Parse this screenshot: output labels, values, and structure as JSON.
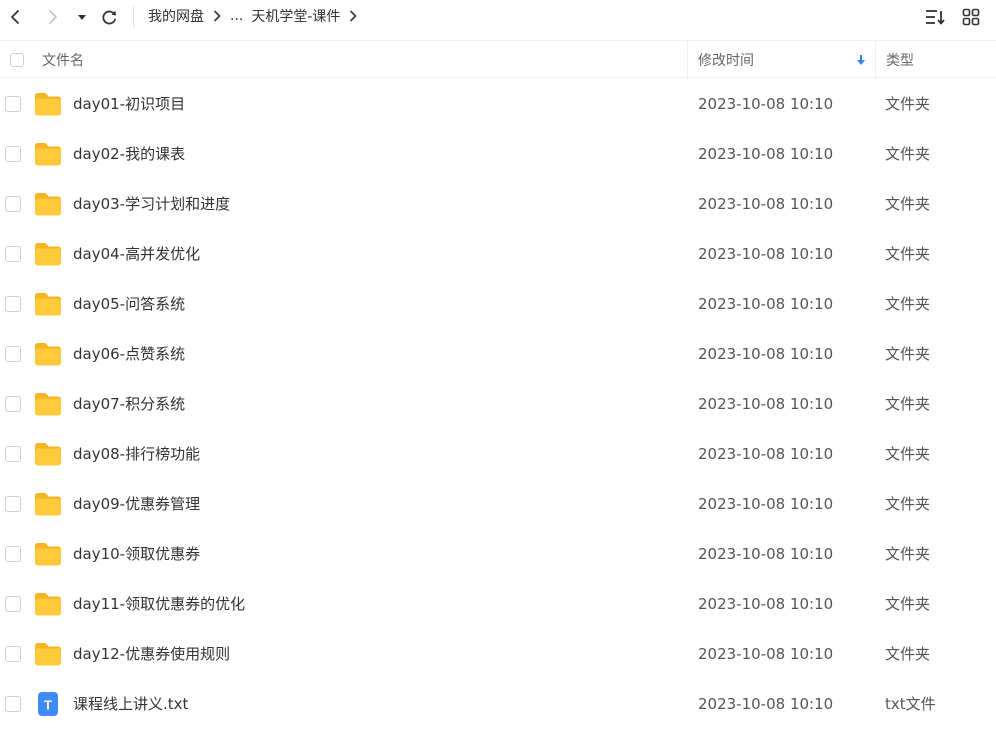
{
  "toolbar": {
    "icons": [
      "back-icon",
      "forward-icon",
      "history-dropdown-icon",
      "refresh-icon",
      "sort-icon",
      "grid-view-icon"
    ]
  },
  "breadcrumb": {
    "root": "我的网盘",
    "ellipsis": "...",
    "current": "天机学堂-课件"
  },
  "header": {
    "name": "文件名",
    "modified": "修改时间",
    "type": "类型"
  },
  "colors": {
    "folder": "#FFC93C",
    "folder_tab": "#F5B520",
    "txt_icon": "#3E8BF5",
    "sort_arrow": "#2E86F0"
  },
  "files": [
    {
      "name": "day01-初识项目",
      "time": "2023-10-08 10:10",
      "type": "文件夹",
      "icon": "folder-icon"
    },
    {
      "name": "day02-我的课表",
      "time": "2023-10-08 10:10",
      "type": "文件夹",
      "icon": "folder-icon"
    },
    {
      "name": "day03-学习计划和进度",
      "time": "2023-10-08 10:10",
      "type": "文件夹",
      "icon": "folder-icon"
    },
    {
      "name": "day04-高并发优化",
      "time": "2023-10-08 10:10",
      "type": "文件夹",
      "icon": "folder-icon"
    },
    {
      "name": "day05-问答系统",
      "time": "2023-10-08 10:10",
      "type": "文件夹",
      "icon": "folder-icon"
    },
    {
      "name": "day06-点赞系统",
      "time": "2023-10-08 10:10",
      "type": "文件夹",
      "icon": "folder-icon"
    },
    {
      "name": "day07-积分系统",
      "time": "2023-10-08 10:10",
      "type": "文件夹",
      "icon": "folder-icon"
    },
    {
      "name": "day08-排行榜功能",
      "time": "2023-10-08 10:10",
      "type": "文件夹",
      "icon": "folder-icon"
    },
    {
      "name": "day09-优惠券管理",
      "time": "2023-10-08 10:10",
      "type": "文件夹",
      "icon": "folder-icon"
    },
    {
      "name": "day10-领取优惠券",
      "time": "2023-10-08 10:10",
      "type": "文件夹",
      "icon": "folder-icon"
    },
    {
      "name": "day11-领取优惠券的优化",
      "time": "2023-10-08 10:10",
      "type": "文件夹",
      "icon": "folder-icon"
    },
    {
      "name": "day12-优惠券使用规则",
      "time": "2023-10-08 10:10",
      "type": "文件夹",
      "icon": "folder-icon"
    },
    {
      "name": "课程线上讲义.txt",
      "time": "2023-10-08 10:10",
      "type": "txt文件",
      "icon": "txt-file-icon",
      "icon_letter": "T"
    }
  ]
}
